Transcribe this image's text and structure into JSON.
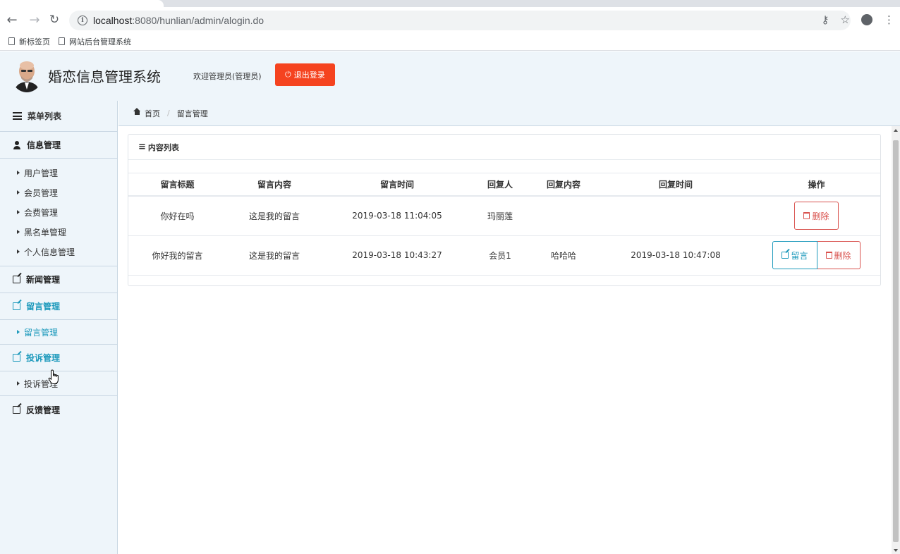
{
  "browser": {
    "url_host": "localhost",
    "url_path": ":8080/hunlian/admin/alogin.do",
    "bookmarks": [
      "新标签页",
      "网站后台管理系统"
    ]
  },
  "header": {
    "title": "婚恋信息管理系统",
    "welcome": "欢迎管理员(管理员)",
    "logout_label": "退出登录",
    "logout_color": "#f5431f"
  },
  "sidebar": {
    "menu_title": "菜单列表",
    "groups": [
      {
        "label": "信息管理",
        "icon": "user-icon",
        "items": [
          "用户管理",
          "会员管理",
          "会费管理",
          "黑名单管理",
          "个人信息管理"
        ]
      },
      {
        "label": "新闻管理",
        "icon": "edit-icon"
      },
      {
        "label": "留言管理",
        "icon": "edit-icon",
        "items": [
          "留言管理"
        ]
      },
      {
        "label": "投诉管理",
        "icon": "edit-icon",
        "items": [
          "投诉管理"
        ]
      },
      {
        "label": "反馈管理",
        "icon": "edit-icon"
      }
    ],
    "accent_color": "#1e9abc"
  },
  "breadcrumb": {
    "home": "首页",
    "current": "留言管理"
  },
  "panel": {
    "title": "内容列表",
    "columns": [
      "留言标题",
      "留言内容",
      "留言时间",
      "回复人",
      "回复内容",
      "回复时间",
      "操作"
    ],
    "rows": [
      {
        "title": "你好在吗",
        "content": "这是我的留言",
        "time": "2019-03-18 11:04:05",
        "replier": "玛丽莲",
        "reply": "",
        "reply_time": ""
      },
      {
        "title": "你好我的留言",
        "content": "这是我的留言",
        "time": "2019-03-18 10:43:27",
        "replier": "会员1",
        "reply": "哈哈哈",
        "reply_time": "2019-03-18 10:47:08"
      }
    ],
    "delete_label": "删除",
    "reply_label": "留言"
  }
}
